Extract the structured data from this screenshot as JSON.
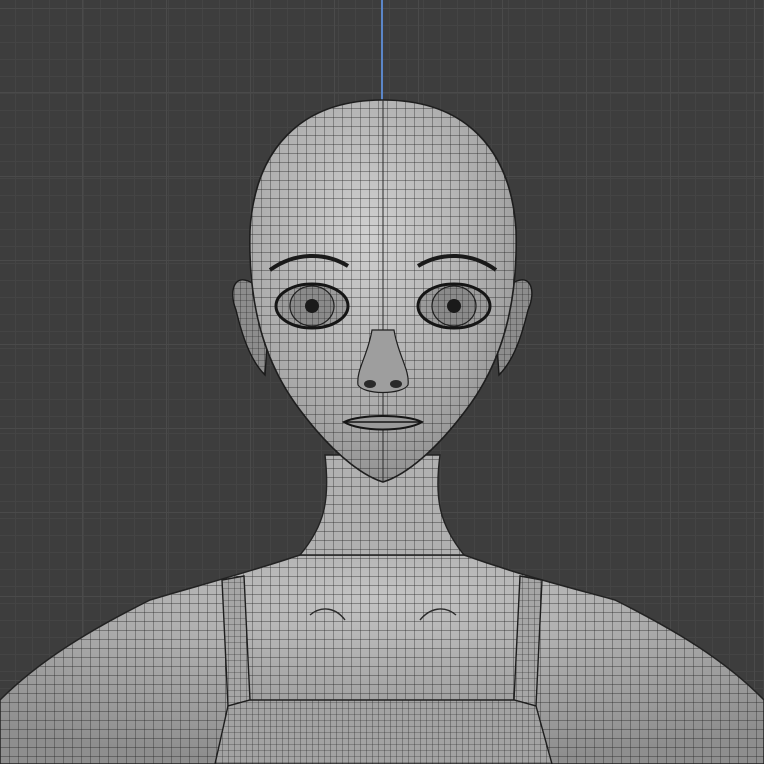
{
  "viewport": {
    "background_color": "#3d3d3d",
    "grid_major_color": "#4a4a4a",
    "grid_minor_color": "#444444",
    "z_axis_color": "#5b86c8"
  },
  "model": {
    "display": "wireframe-on-solid",
    "skin_color": "#b4b4b4",
    "wire_color": "#1c1c1c"
  }
}
